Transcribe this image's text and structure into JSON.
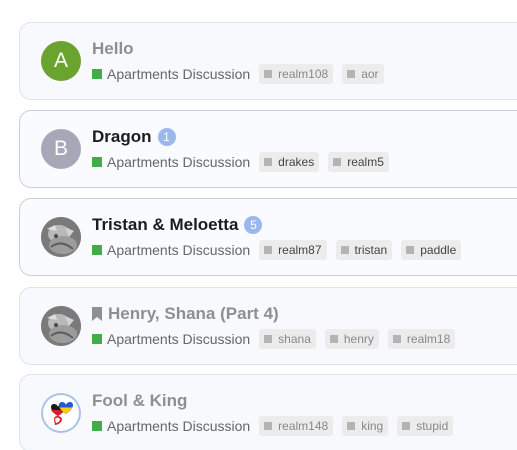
{
  "forum_label": "Apartments Discussion",
  "colors": {
    "forum_square": "#3fae49",
    "badge": "#9bb7ee",
    "avatar_a": "#6aa32e",
    "avatar_b": "#a6a8b8"
  },
  "threads": [
    {
      "title": "Hello",
      "avatar": {
        "type": "letter",
        "letter": "A"
      },
      "unread_count": null,
      "bookmarked": false,
      "tags": [
        "realm108",
        "aor"
      ]
    },
    {
      "title": "Dragon",
      "avatar": {
        "type": "letter",
        "letter": "B"
      },
      "unread_count": "1",
      "bookmarked": false,
      "tags": [
        "drakes",
        "realm5"
      ]
    },
    {
      "title": "Tristan & Meloetta",
      "avatar": {
        "type": "photo",
        "icon": "user-photo"
      },
      "unread_count": "5",
      "bookmarked": false,
      "tags": [
        "realm87",
        "tristan",
        "paddle"
      ]
    },
    {
      "title": "Henry, Shana (Part 4)",
      "avatar": {
        "type": "photo",
        "icon": "user-photo"
      },
      "unread_count": null,
      "bookmarked": true,
      "tags": [
        "shana",
        "henry",
        "realm18"
      ]
    },
    {
      "title": "Fool & King",
      "avatar": {
        "type": "image",
        "icon": "hearts-flag-avatar"
      },
      "unread_count": null,
      "bookmarked": false,
      "tags": [
        "realm148",
        "king",
        "stupid"
      ]
    }
  ]
}
